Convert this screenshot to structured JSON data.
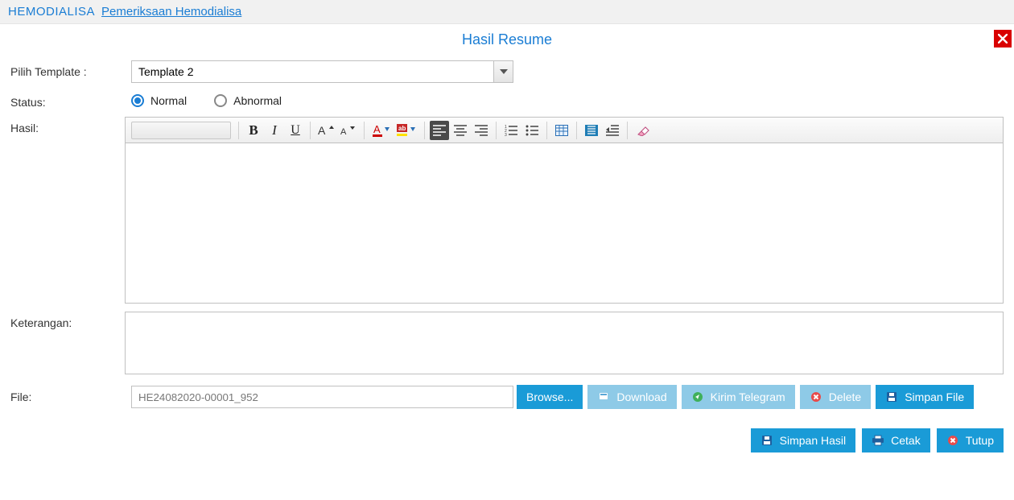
{
  "header": {
    "module": "HEMODIALISA",
    "page": "Pemeriksaan Hemodialisa"
  },
  "panel": {
    "title": "Hasil Resume"
  },
  "labels": {
    "template": "Pilih Template :",
    "status": "Status:",
    "hasil": "Hasil:",
    "ket": "Keterangan:",
    "file": "File:"
  },
  "template": {
    "value": "Template 2"
  },
  "status": {
    "options": {
      "normal": "Normal",
      "abnormal": "Abnormal"
    },
    "selected": "normal"
  },
  "file": {
    "value": "HE24082020-00001_952",
    "browse": "Browse...",
    "download": "Download",
    "telegram": "Kirim Telegram",
    "delete": "Delete",
    "save": "Simpan File"
  },
  "footer": {
    "save": "Simpan Hasil",
    "print": "Cetak",
    "close": "Tutup"
  }
}
